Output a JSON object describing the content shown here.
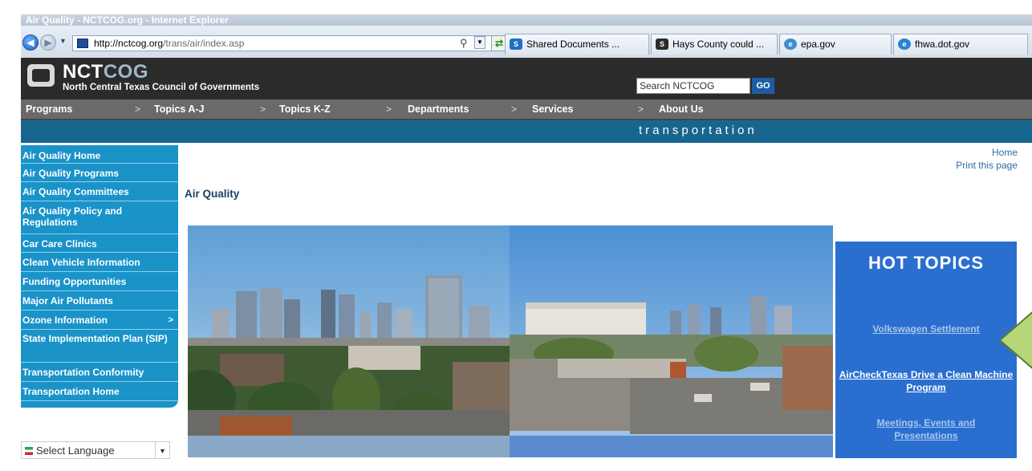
{
  "browser": {
    "window_title": "Air Quality - NCTCOG.org - Internet Explorer",
    "address_domain": "http://nctcog.org",
    "address_path": "/trans/air/index.asp",
    "tabs": [
      {
        "label": "Shared Documents ...",
        "icon_color": "#1e6fc5",
        "icon_text": "S"
      },
      {
        "label": "Hays County could ...",
        "icon_color": "#2b2b2b",
        "icon_text": "S"
      },
      {
        "label": "epa.gov",
        "icon_color": "#3d8fd1",
        "icon_text": "e"
      },
      {
        "label": "fhwa.dot.gov",
        "icon_color": "#2a84d6",
        "icon_text": "e"
      }
    ]
  },
  "header": {
    "logo_prefix": "NCT",
    "logo_suffix": "COG",
    "logo_subtitle": "North Central Texas Council of Governments",
    "search_placeholder": "Search NCTCOG",
    "go_label": "GO"
  },
  "menu": [
    {
      "label": "Programs"
    },
    {
      "label": "Topics A-J"
    },
    {
      "label": "Topics K-Z"
    },
    {
      "label": "Departments"
    },
    {
      "label": "Services"
    },
    {
      "label": "About Us"
    }
  ],
  "section_band": "transportation",
  "sidebar": [
    {
      "label": "Air Quality Home"
    },
    {
      "label": "Air Quality Programs"
    },
    {
      "label": "Air Quality Committees"
    },
    {
      "label": "Air Quality Policy and Regulations"
    },
    {
      "label": "Car Care Clinics"
    },
    {
      "label": "Clean Vehicle Information"
    },
    {
      "label": "Funding Opportunities"
    },
    {
      "label": "Major Air Pollutants"
    },
    {
      "label": "Ozone Information",
      "arrow": ">"
    },
    {
      "label": "State Implementation Plan (SIP)"
    },
    {
      "label": "Transportation Conformity"
    },
    {
      "label": "Transportation Home"
    }
  ],
  "language_select": "Select Language",
  "top_links": {
    "home": "Home",
    "print": "Print this page"
  },
  "page_title": "Air Quality",
  "hot_topics": {
    "title": "HOT TOPICS",
    "links": [
      {
        "label": "Volkswagen Settlement",
        "color": "#a9c7ee"
      },
      {
        "label": "AirCheckTexas Drive a Clean Machine Program",
        "color": "#ffffff"
      },
      {
        "label": "Meetings, Events and Presentations",
        "color": "#a9c7ee"
      }
    ]
  },
  "colors": {
    "sidebar_bg": "#1a93c9",
    "band_bg": "#16668f",
    "hot_bg": "#2a6fd0",
    "callout_green": "#b6d779"
  }
}
